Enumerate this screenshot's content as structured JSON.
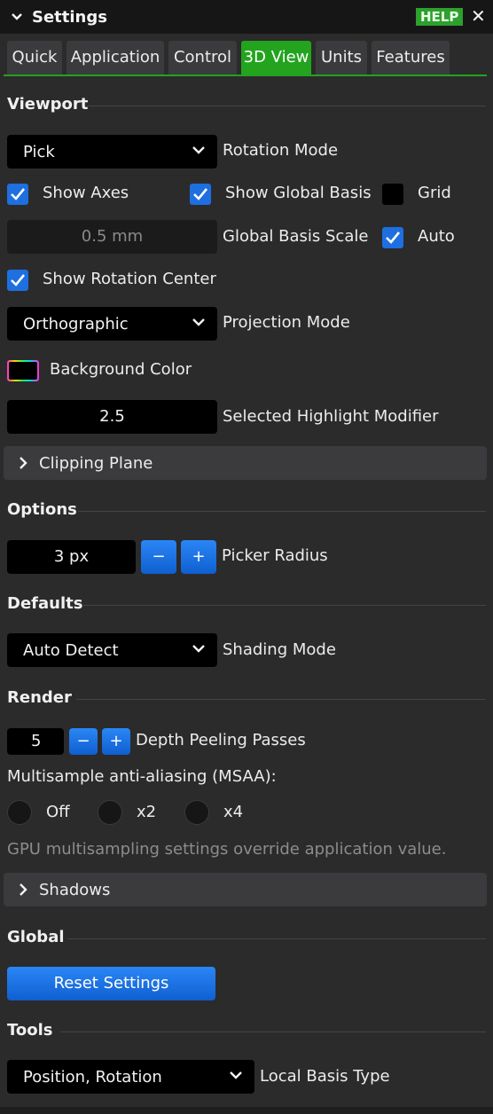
{
  "window": {
    "title": "Settings",
    "help_label": "HELP",
    "close_glyph": "✕"
  },
  "tabs": [
    {
      "label": "Quick",
      "active": false
    },
    {
      "label": "Application",
      "active": false
    },
    {
      "label": "Control",
      "active": false
    },
    {
      "label": "3D View",
      "active": true
    },
    {
      "label": "Units",
      "active": false
    },
    {
      "label": "Features",
      "active": false
    }
  ],
  "viewport": {
    "heading": "Viewport",
    "rotation_mode": {
      "value": "Pick",
      "label": "Rotation Mode"
    },
    "show_axes": {
      "label": "Show Axes",
      "checked": true
    },
    "show_global_basis": {
      "label": "Show Global Basis",
      "checked": true
    },
    "grid": {
      "label": "Grid",
      "checked": false
    },
    "global_basis_scale": {
      "value": "0.5 mm",
      "label": "Global Basis Scale"
    },
    "auto": {
      "label": "Auto",
      "checked": true
    },
    "show_rotation_center": {
      "label": "Show Rotation Center",
      "checked": true
    },
    "projection_mode": {
      "value": "Orthographic",
      "label": "Projection Mode"
    },
    "background_color": {
      "label": "Background Color"
    },
    "selected_highlight": {
      "value": "2.5",
      "label": "Selected Highlight Modifier"
    },
    "clipping_plane": {
      "label": "Clipping Plane",
      "expanded": false
    }
  },
  "options": {
    "heading": "Options",
    "picker_radius": {
      "value": "3 px",
      "minus": "−",
      "plus": "+",
      "label": "Picker Radius"
    }
  },
  "defaults": {
    "heading": "Defaults",
    "shading_mode": {
      "value": "Auto Detect",
      "label": "Shading Mode"
    }
  },
  "render": {
    "heading": "Render",
    "depth_peeling": {
      "value": "5",
      "minus": "−",
      "plus": "+",
      "label": "Depth Peeling Passes"
    },
    "msaa_label": "Multisample anti-aliasing (MSAA):",
    "msaa_options": [
      {
        "label": "Off",
        "selected": false
      },
      {
        "label": "x2",
        "selected": false
      },
      {
        "label": "x4",
        "selected": false
      }
    ],
    "msaa_note": "GPU multisampling settings override application value.",
    "shadows": {
      "label": "Shadows",
      "expanded": false
    }
  },
  "global": {
    "heading": "Global",
    "reset_label": "Reset Settings"
  },
  "tools": {
    "heading": "Tools",
    "local_basis": {
      "value": "Position, Rotation",
      "label": "Local Basis Type"
    }
  },
  "colors": {
    "accent_green": "#23a31e",
    "accent_blue": "#1e6fe0",
    "panel_bg": "#2b2b2c"
  }
}
